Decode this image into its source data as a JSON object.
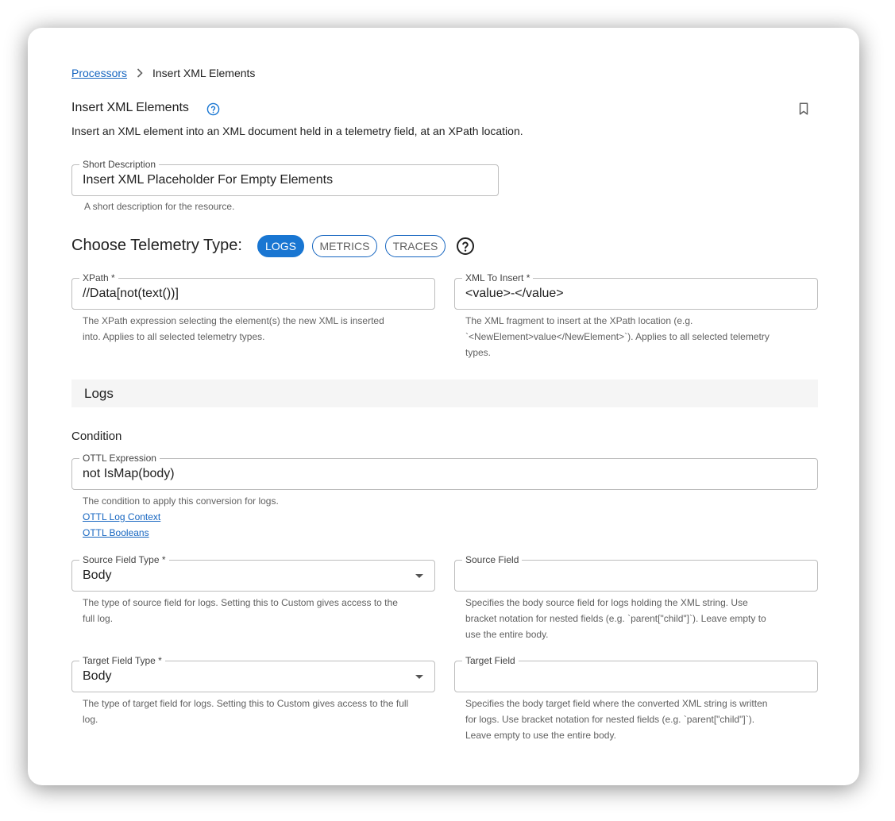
{
  "breadcrumb": {
    "parent": "Processors",
    "current": "Insert XML Elements"
  },
  "header": {
    "title": "Insert XML Elements",
    "description": "Insert an XML element into an XML document held in a telemetry field, at an XPath location."
  },
  "short_description": {
    "label": "Short Description",
    "value": "Insert XML Placeholder For Empty Elements",
    "helper": "A short description for the resource."
  },
  "telemetry": {
    "title": "Choose Telemetry Type:",
    "options": [
      "LOGS",
      "METRICS",
      "TRACES"
    ],
    "selected": "LOGS"
  },
  "xpath": {
    "label": "XPath *",
    "value": "//Data[not(text())]",
    "helper_line1": "The XPath expression selecting the element(s) the new XML is inserted",
    "helper_line2": "into. Applies to all selected telemetry types."
  },
  "xml_insert": {
    "label": "XML To Insert *",
    "value": "<value>-</value>",
    "helper_line1": "The XML fragment to insert at the XPath location (e.g.",
    "helper_line2": "`<NewElement>value</NewElement>`). Applies to all selected telemetry",
    "helper_line3": "types."
  },
  "logs_section": {
    "title": "Logs",
    "condition_label": "Condition",
    "ottl": {
      "label": "OTTL Expression",
      "value": "not IsMap(body)",
      "helper": "The condition to apply this conversion for logs.",
      "link1": "OTTL Log Context",
      "link2": "OTTL Booleans"
    },
    "source_type": {
      "label": "Source Field Type *",
      "value": "Body",
      "helper_line1": "The type of source field for logs. Setting this to Custom gives access to the",
      "helper_line2": "full log."
    },
    "source_field": {
      "label": "Source Field",
      "value": "",
      "helper_line1": "Specifies the body source field for logs holding the XML string. Use",
      "helper_line2": "bracket notation for nested fields (e.g. `parent[\"child\"]`). Leave empty to",
      "helper_line3": "use the entire body."
    },
    "target_type": {
      "label": "Target Field Type *",
      "value": "Body",
      "helper_line1": "The type of target field for logs. Setting this to Custom gives access to the full",
      "helper_line2": "log."
    },
    "target_field": {
      "label": "Target Field",
      "value": "",
      "helper_line1": "Specifies the body target field where the converted XML string is written",
      "helper_line2": "for logs. Use bracket notation for nested fields (e.g. `parent[\"child\"]`).",
      "helper_line3": "Leave empty to use the entire body."
    }
  },
  "icons": {
    "help": "help-circle-icon",
    "bookmark": "bookmark-icon",
    "chevron": "chevron-right-icon",
    "dropdown": "caret-down-icon"
  },
  "colors": {
    "accent": "#1976d2",
    "link": "#1565c0"
  }
}
